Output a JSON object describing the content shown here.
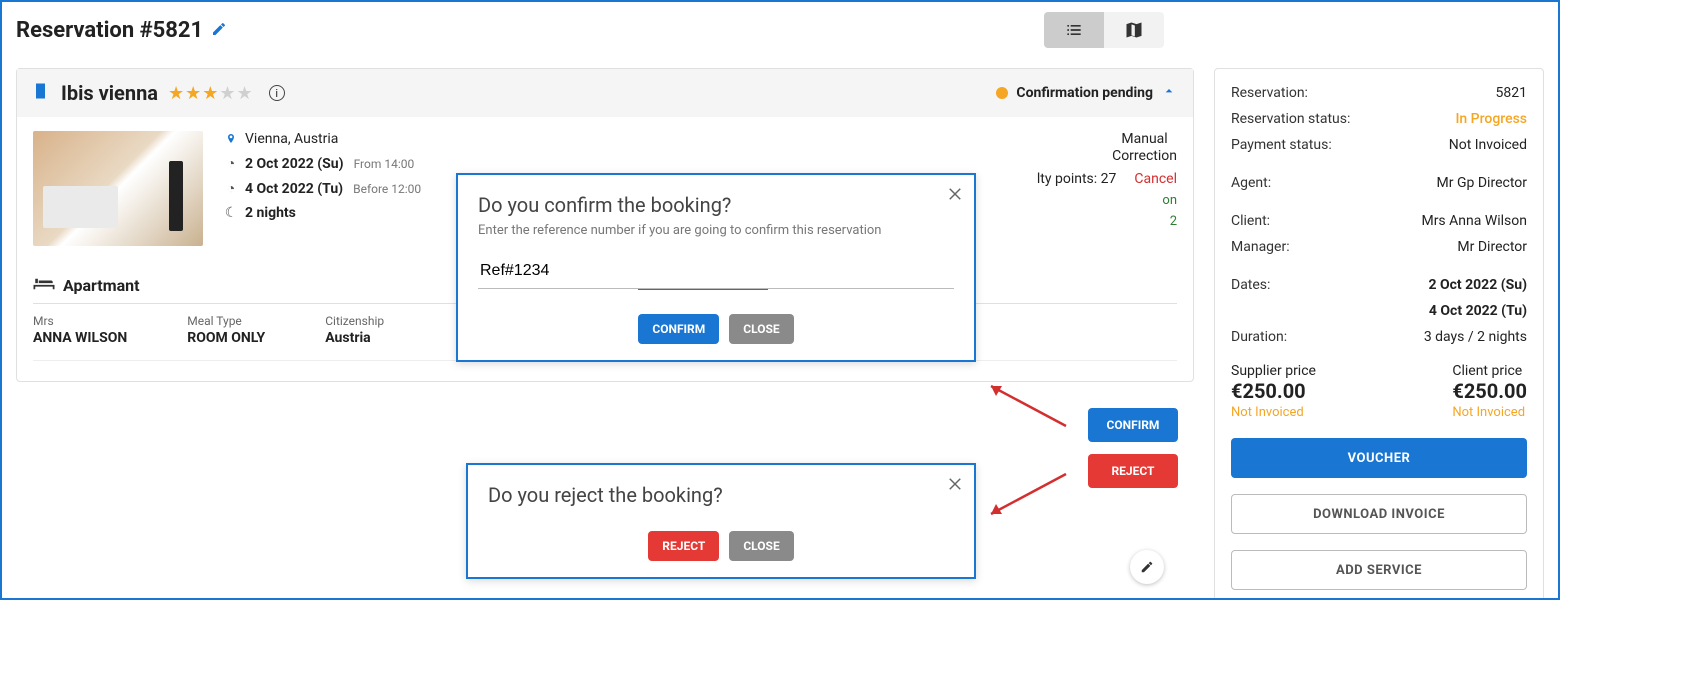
{
  "page": {
    "title": "Reservation #5821"
  },
  "hotel": {
    "name": "Ibis vienna",
    "stars": 3,
    "status": "Confirmation pending",
    "location": "Vienna, Austria",
    "checkin_date": "2 Oct 2022 (Su)",
    "checkin_sub": "From 14:00",
    "checkout_date": "4 Oct 2022 (Tu)",
    "checkout_sub": "Before 12:00",
    "nights": "2 nights",
    "manual_correction": "Manual\nCorrection",
    "loyalty": "lty points: 27",
    "cancel": "Cancel",
    "green1": "on",
    "green2": "2"
  },
  "actions": {
    "confirm": "CONFIRM",
    "reject": "REJECT"
  },
  "room": {
    "title": "Apartmant",
    "guest_prefix": "Mrs",
    "guest_name": "ANNA WILSON",
    "meal_label": "Meal Type",
    "meal_value": "ROOM ONLY",
    "citizen_label": "Citizenship",
    "citizen_value": "Austria"
  },
  "side": {
    "reservation_lbl": "Reservation:",
    "reservation_val": "5821",
    "rstatus_lbl": "Reservation status:",
    "rstatus_val": "In Progress",
    "pstatus_lbl": "Payment status:",
    "pstatus_val": "Not Invoiced",
    "agent_lbl": "Agent:",
    "agent_val": "Mr Gp Director",
    "client_lbl": "Client:",
    "client_val": "Mrs Anna Wilson",
    "manager_lbl": "Manager:",
    "manager_val": "Mr Director",
    "dates_lbl": "Dates:",
    "dates_val1": "2 Oct 2022 (Su)",
    "dates_val2": "4 Oct 2022 (Tu)",
    "duration_lbl": "Duration:",
    "duration_val": "3 days / 2 nights",
    "sprice_lbl": "Supplier price",
    "sprice_val": "€250.00",
    "sprice_status": "Not Invoiced",
    "cprice_lbl": "Client price",
    "cprice_val": "€250.00",
    "cprice_status": "Not Invoiced",
    "voucher_btn": "VOUCHER",
    "invoice_btn": "DOWNLOAD INVOICE",
    "add_service_btn": "ADD SERVICE"
  },
  "modal_confirm": {
    "title": "Do you confirm the booking?",
    "hint": "Enter the reference number if you are going to confirm this reservation",
    "ref": "Ref#1234",
    "confirm": "CONFIRM",
    "close": "CLOSE"
  },
  "modal_reject": {
    "title": "Do you reject the booking?",
    "reject": "REJECT",
    "close": "CLOSE"
  }
}
